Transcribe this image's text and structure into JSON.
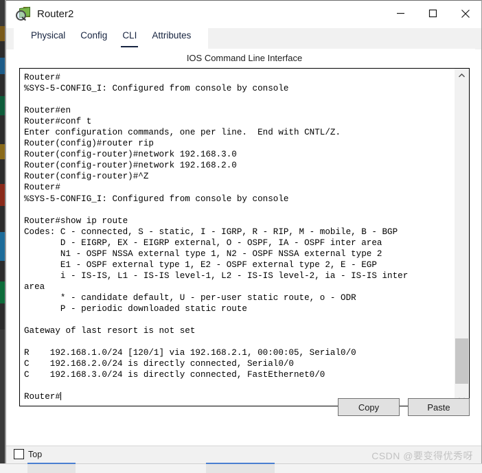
{
  "window": {
    "title": "Router2",
    "icon": "router-inspect-icon",
    "controls": {
      "minimize": "minimize-icon",
      "maximize": "maximize-icon",
      "close": "close-icon"
    }
  },
  "tabs": [
    {
      "label": "Physical",
      "active": false
    },
    {
      "label": "Config",
      "active": false
    },
    {
      "label": "CLI",
      "active": true
    },
    {
      "label": "Attributes",
      "active": false
    }
  ],
  "panel": {
    "header": "IOS Command Line Interface"
  },
  "terminal": {
    "lines": [
      "Router#",
      "%SYS-5-CONFIG_I: Configured from console by console",
      "",
      "Router#en",
      "Router#conf t",
      "Enter configuration commands, one per line.  End with CNTL/Z.",
      "Router(config)#router rip",
      "Router(config-router)#network 192.168.3.0",
      "Router(config-router)#network 192.168.2.0",
      "Router(config-router)#^Z",
      "Router#",
      "%SYS-5-CONFIG_I: Configured from console by console",
      "",
      "Router#show ip route",
      "Codes: C - connected, S - static, I - IGRP, R - RIP, M - mobile, B - BGP",
      "       D - EIGRP, EX - EIGRP external, O - OSPF, IA - OSPF inter area",
      "       N1 - OSPF NSSA external type 1, N2 - OSPF NSSA external type 2",
      "       E1 - OSPF external type 1, E2 - OSPF external type 2, E - EGP",
      "       i - IS-IS, L1 - IS-IS level-1, L2 - IS-IS level-2, ia - IS-IS inter",
      "area",
      "       * - candidate default, U - per-user static route, o - ODR",
      "       P - periodic downloaded static route",
      "",
      "Gateway of last resort is not set",
      "",
      "R    192.168.1.0/24 [120/1] via 192.168.2.1, 00:00:05, Serial0/0",
      "C    192.168.2.0/24 is directly connected, Serial0/0",
      "C    192.168.3.0/24 is directly connected, FastEthernet0/0",
      "",
      "Router#"
    ],
    "prompt_cursor": true
  },
  "scrollbar": {
    "up_arrow": "chevron-up-icon",
    "down_arrow": "chevron-down-icon"
  },
  "actions": {
    "copy_label": "Copy",
    "paste_label": "Paste"
  },
  "footer": {
    "top_checkbox_label": "Top",
    "top_checkbox_checked": false,
    "watermark": "CSDN @要变得优秀呀"
  },
  "colors": {
    "tab_active": "#16233f",
    "window_bg": "#ffffff",
    "chrome_bg": "#f1f1f1",
    "button_bg": "#e1e1e1",
    "scrollbar_thumb": "#c6c6c6"
  }
}
